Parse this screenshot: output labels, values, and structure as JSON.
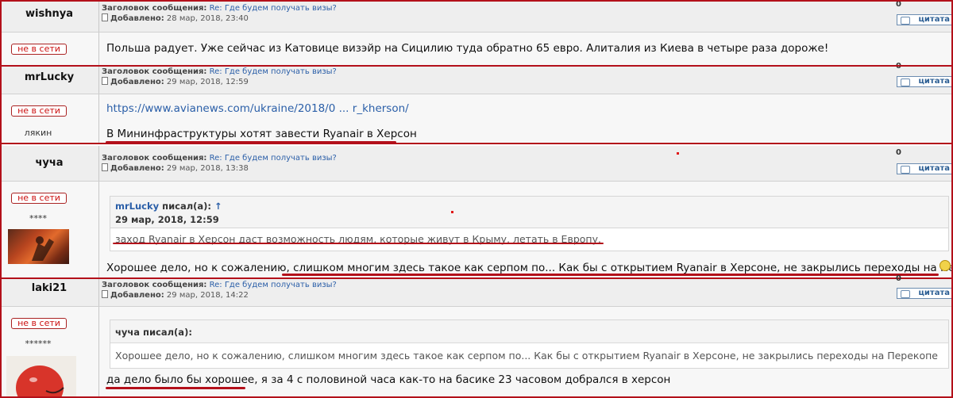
{
  "posts": [
    {
      "author": "wishnya",
      "subject_label": "Заголовок сообщения:",
      "subject": "Re: Где будем получать визы?",
      "added_label": "Добавлено:",
      "date": "28 мар, 2018, 23:40",
      "karma": "0",
      "quote_btn": "цитата",
      "status": "не в сети",
      "text": "Польша радует. Уже сейчас из Катовице визэйр на Сицилию туда обратно 65 евро. Алиталия из Киева в четыре раза дороже!"
    },
    {
      "author": "mrLucky",
      "subject_label": "Заголовок сообщения:",
      "subject": "Re: Где будем получать визы?",
      "added_label": "Добавлено:",
      "date": "29 мар, 2018, 12:59",
      "karma": "0",
      "quote_btn": "цитата",
      "status": "не в сети",
      "rank": "лякин",
      "link": "https://www.avianews.com/ukraine/2018/0 ... r_kherson/",
      "text": "В Мининфраструктуры хотят завести Ryanair в Херсон"
    },
    {
      "author": "чуча",
      "subject_label": "Заголовок сообщения:",
      "subject": "Re: Где будем получать визы?",
      "added_label": "Добавлено:",
      "date": "29 мар, 2018, 13:38",
      "karma": "0",
      "quote_btn": "цитата",
      "status": "не в сети",
      "rank": "****",
      "quote_author": "mrLucky",
      "quote_said": "писал(а):",
      "quote_arrow": "↑",
      "quote_date": "29 мар, 2018, 12:59",
      "quote_text": "заход Ryanair в Херсон даст возможность людям, которые живут в Крыму, летать в Европу.",
      "text_a": "Хорошее дело, но к сожалению, ",
      "text_b": "слишком многим здесь такое как серпом по... Как бы с открытием Ryanair в Херсоне, не закрылись переходы на Перекопе"
    },
    {
      "author": "laki21",
      "subject_label": "Заголовок сообщения:",
      "subject": "Re: Где будем получать визы?",
      "added_label": "Добавлено:",
      "date": "29 мар, 2018, 14:22",
      "karma": "0",
      "quote_btn": "цитата",
      "status": "не в сети",
      "rank": "******",
      "quote_header": "чуча писал(а):",
      "quote_text": "Хорошее дело, но к сожалению, слишком многим здесь такое как серпом по... Как бы с открытием Ryanair в Херсоне, не закрылись переходы на Перекопе",
      "text_a": "да дело было бы хорошее",
      "text_b": ", я за 4 с половиной часа как-то на басике 23 часовом добрался в херсон"
    }
  ],
  "colors": {
    "annotation_red": "#b3101a",
    "offline_red": "#cc1111",
    "link_blue": "#2b5fa8"
  }
}
